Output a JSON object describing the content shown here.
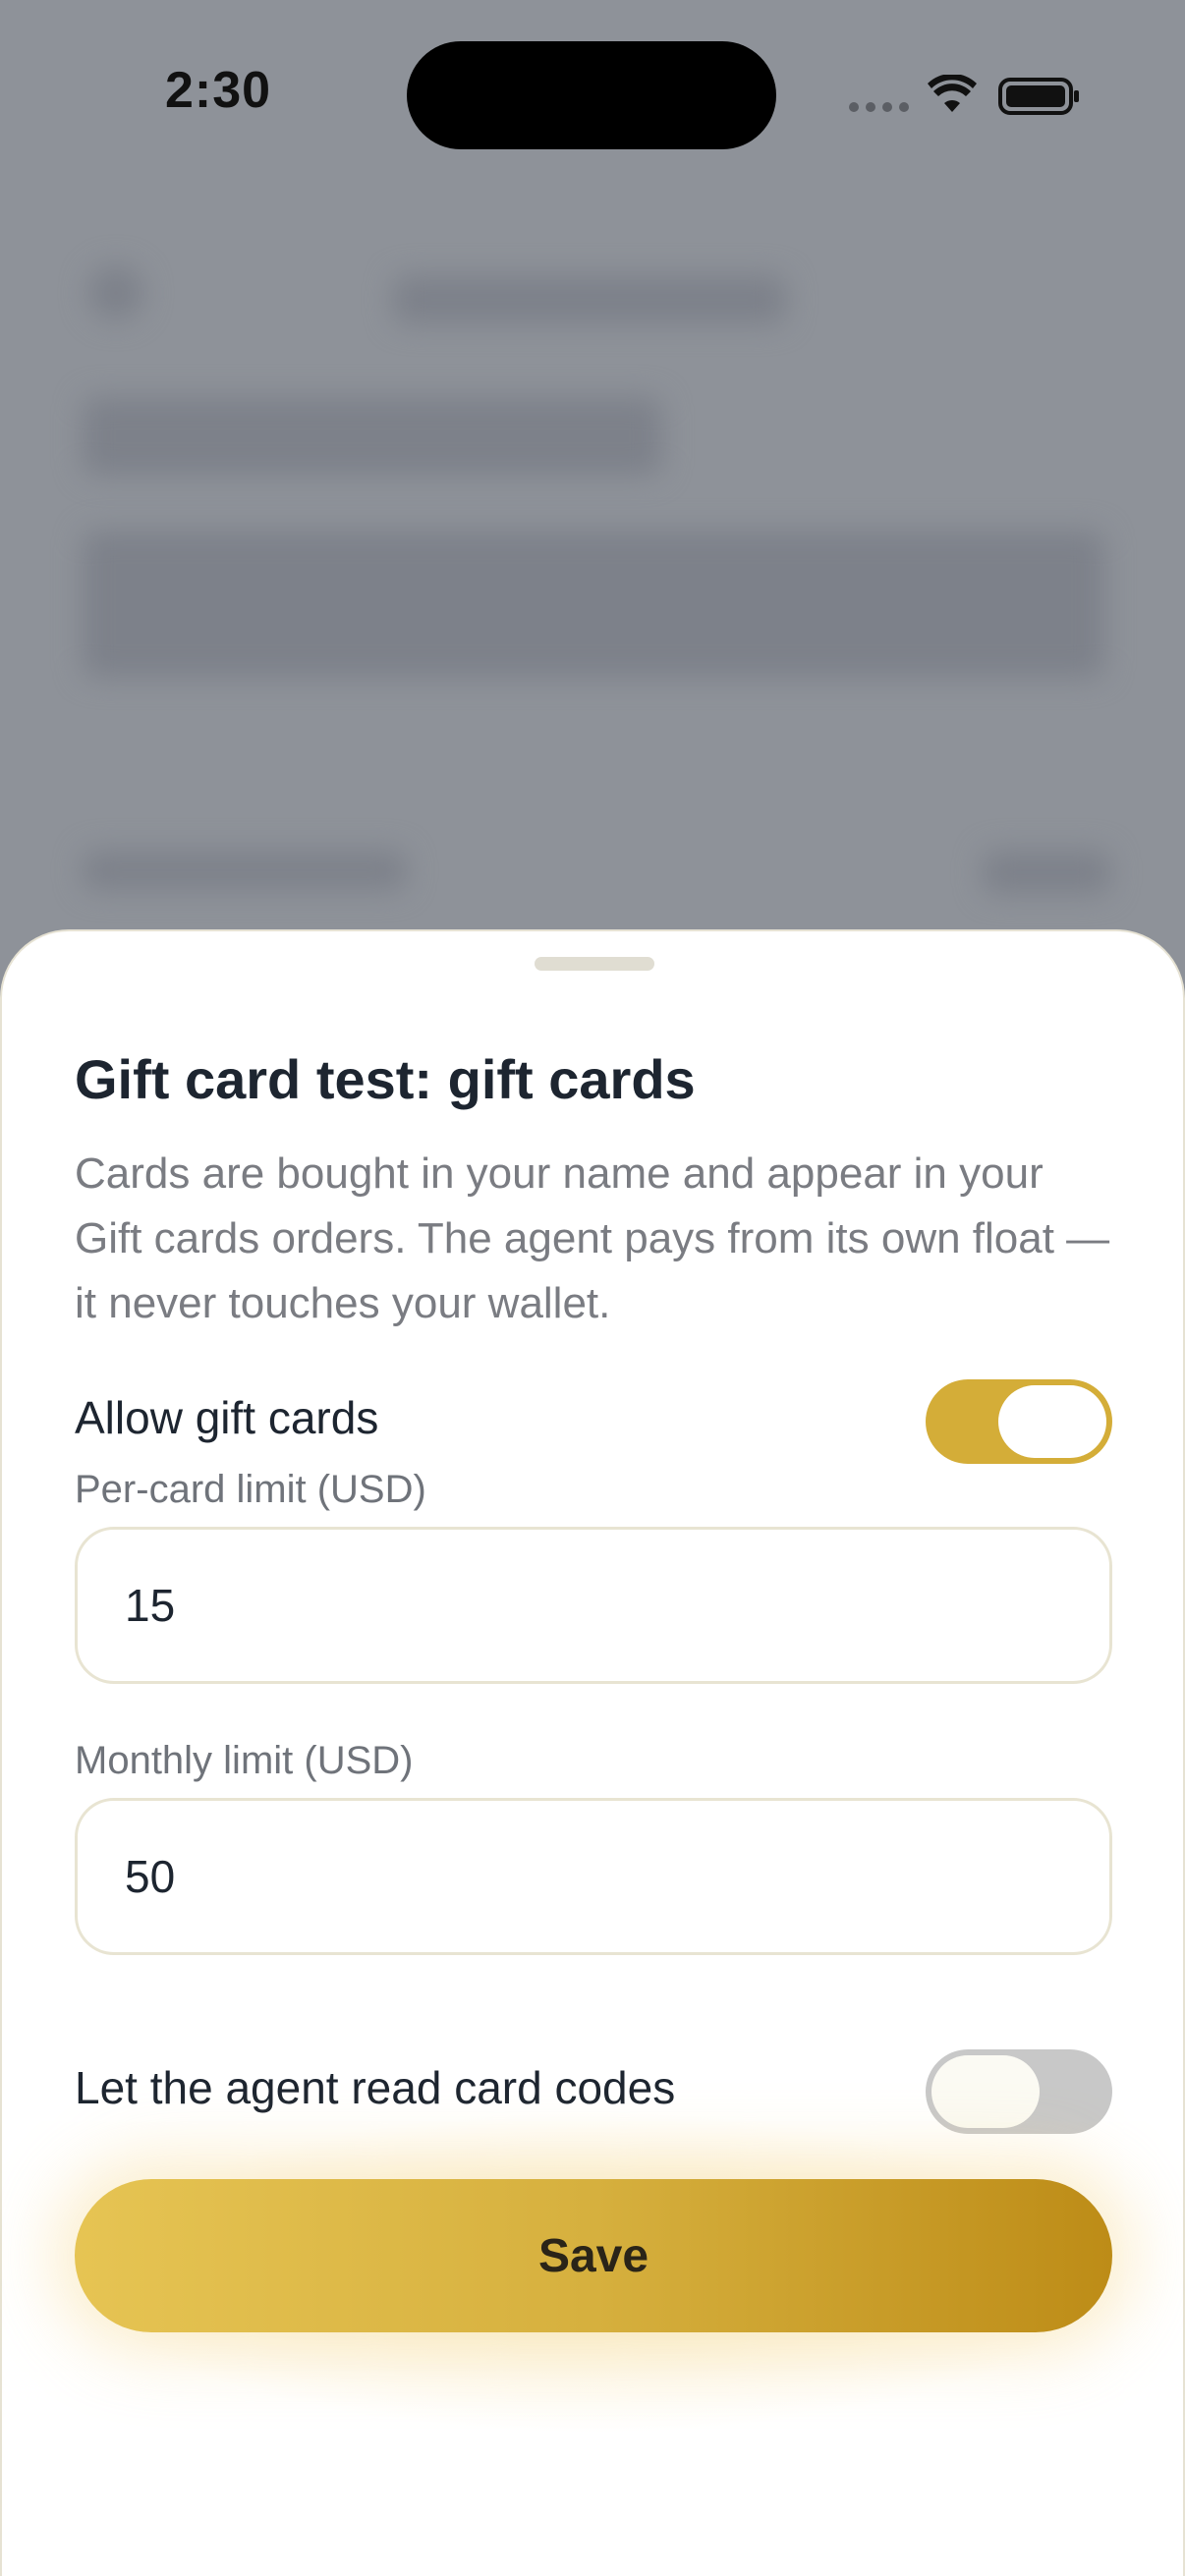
{
  "status_bar": {
    "time": "2:30"
  },
  "sheet": {
    "title": "Gift card test: gift cards",
    "description": "Cards are bought in your name and appear in your Gift cards orders. The agent pays from its own float — it never touches your wallet.",
    "allow_gift_cards": {
      "label": "Allow gift cards",
      "enabled": true
    },
    "per_card_limit": {
      "label": "Per-card limit (USD)",
      "value": "15"
    },
    "monthly_limit": {
      "label": "Monthly limit (USD)",
      "value": "50"
    },
    "read_card_codes": {
      "label": "Let the agent read card codes",
      "enabled": false
    },
    "save_label": "Save"
  },
  "colors": {
    "accent": "#d4ad38",
    "text_primary": "#1d2530",
    "text_secondary": "#7a7c82"
  }
}
